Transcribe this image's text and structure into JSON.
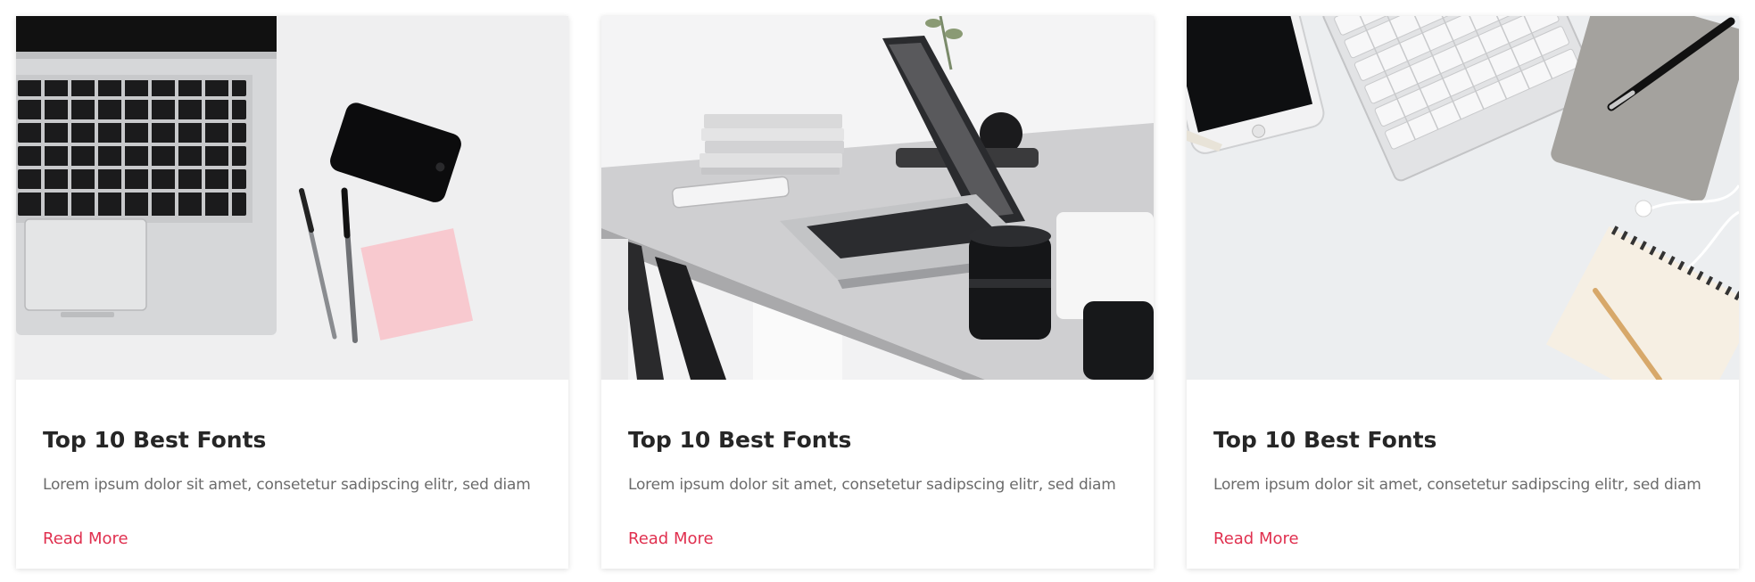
{
  "cards": [
    {
      "image": "laptop-phone-pens-flatlay",
      "title": "Top 10 Best Fonts",
      "excerpt": "Lorem ipsum dolor sit amet, consetetur sadipscing elitr, sed diam",
      "link": "Read More"
    },
    {
      "image": "laptop-on-desk-with-camera-lens",
      "title": "Top 10 Best Fonts",
      "excerpt": "Lorem ipsum dolor sit amet, consetetur sadipscing elitr, sed diam",
      "link": "Read More"
    },
    {
      "image": "phone-keyboard-notebook-flatlay",
      "title": "Top 10 Best Fonts",
      "excerpt": "Lorem ipsum dolor sit amet, consetetur sadipscing elitr, sed diam",
      "link": "Read More"
    }
  ],
  "colors": {
    "accent": "#e0304f",
    "title": "#262626",
    "text": "#6b6b6b"
  }
}
